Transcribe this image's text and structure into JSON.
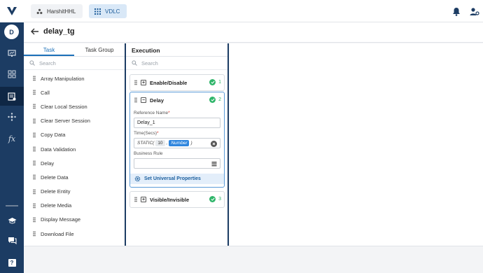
{
  "app": {
    "logo": "V"
  },
  "user": {
    "initial": "D"
  },
  "topbar": {
    "workspace_chip": "HarshitHHL",
    "project_chip": "VDLC"
  },
  "rail": {
    "icons": [
      "monitor-icon",
      "network-icon",
      "task-flow-icon",
      "hub-icon",
      "function-icon",
      "learn-icon",
      "chat-icon",
      "help-icon"
    ]
  },
  "page": {
    "title": "delay_tg"
  },
  "task_panel": {
    "tabs": [
      {
        "label": "Task",
        "active": true
      },
      {
        "label": "Task Group",
        "active": false
      }
    ],
    "search_placeholder": "Search",
    "items": [
      "Array Manipulation",
      "Call",
      "Clear Local Session",
      "Clear Server Session",
      "Copy Data",
      "Data Validation",
      "Delay",
      "Delete Data",
      "Delete Entity",
      "Delete Media",
      "Display Message",
      "Download File"
    ]
  },
  "execution": {
    "title": "Execution",
    "search_placeholder": "Search",
    "cards": [
      {
        "label": "Enable/Disable",
        "order": "1",
        "expanded": false
      },
      {
        "label": "Delay",
        "order": "2",
        "expanded": true
      },
      {
        "label": "Visible/Invisible",
        "order": "3",
        "expanded": false
      }
    ],
    "delay_form": {
      "reference_label": "Reference Name",
      "reference_value": "Delay_1",
      "time_label": "Time(Secs)",
      "time_static": "STATIC(",
      "time_value": "10",
      "time_sep": ",",
      "time_type": "Number",
      "time_close": ")",
      "business_rule_label": "Business Rule",
      "business_rule_value": "",
      "universal_label": "Set Universal Properties"
    }
  },
  "colors": {
    "rail": "#1c3c63",
    "accent": "#1b6fb8",
    "success": "#2fb56a",
    "required": "#d9352b"
  }
}
